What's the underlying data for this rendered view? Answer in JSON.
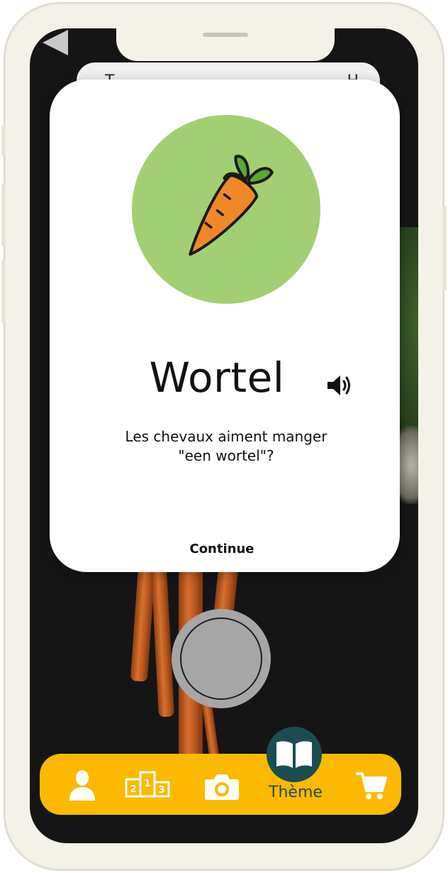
{
  "background": {
    "back_card_label_left": "T",
    "back_card_label_right": "H"
  },
  "modal": {
    "word": "Wortel",
    "question_line1": "Les chevaux aiment manger",
    "question_line2": "\"een wortel\"?",
    "continue_label": "Continue",
    "illustration_icon": "carrot-icon",
    "circle_color": "#a2cf73"
  },
  "bottom_nav": {
    "items": [
      {
        "icon": "user-icon",
        "label": ""
      },
      {
        "icon": "podium-icon",
        "label": ""
      },
      {
        "icon": "camera-icon",
        "label": ""
      },
      {
        "icon": "book-icon",
        "label": "Thème",
        "active": true
      },
      {
        "icon": "cart-icon",
        "label": ""
      }
    ],
    "podium_digits": [
      "2",
      "1",
      "3"
    ],
    "bar_color": "#fcb900",
    "active_color": "#1a4d52"
  }
}
